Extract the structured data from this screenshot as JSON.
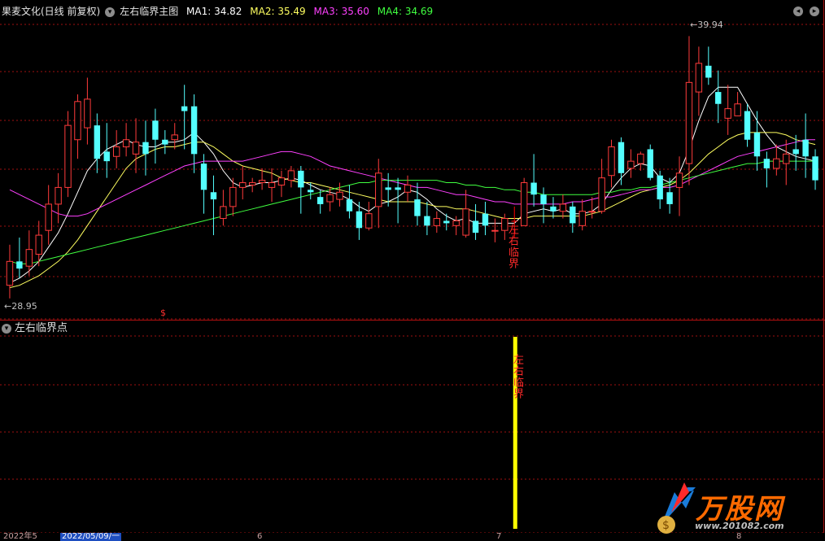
{
  "header": {
    "stock_name": "果麦文化(日线 前复权)",
    "indicator_name": "左右临界主图",
    "ma1": "MA1: 34.82",
    "ma2": "MA2: 35.49",
    "ma3": "MA3: 35.60",
    "ma4": "MA4: 34.69"
  },
  "sub_header": {
    "indicator_name": "左右临界点"
  },
  "price_labels": {
    "high": "39.94",
    "low": "28.95",
    "dollar_marker": "$"
  },
  "signal": {
    "main_label": "左右临界",
    "sub_label": "左右临界"
  },
  "axis": {
    "dates": [
      "2022年5",
      "6",
      "7",
      "8"
    ],
    "cursor_date": "2022/05/09/一"
  },
  "logo": {
    "text": "万股网",
    "url": "www.201082.com"
  },
  "colors": {
    "up": "#ff3b3b",
    "down": "#54ffff",
    "ma1": "#ffffff",
    "ma2": "#ffff60",
    "ma3": "#ff40ff",
    "ma4": "#40ff40",
    "grid": "#a01010",
    "signal_bar": "#ffff00",
    "signal_candle": "#ff0000"
  },
  "chart_data": {
    "type": "candlestick",
    "ylim": [
      28.5,
      40.5
    ],
    "candles": [
      {
        "o": 29.5,
        "c": 30.5,
        "h": 31.2,
        "l": 28.95
      },
      {
        "o": 30.5,
        "c": 30.2,
        "h": 31.5,
        "l": 29.8
      },
      {
        "o": 30.3,
        "c": 31.0,
        "h": 31.8,
        "l": 29.9
      },
      {
        "o": 30.8,
        "c": 31.6,
        "h": 32.2,
        "l": 30.3
      },
      {
        "o": 31.8,
        "c": 32.9,
        "h": 33.7,
        "l": 31.2
      },
      {
        "o": 32.9,
        "c": 33.6,
        "h": 34.2,
        "l": 32.1
      },
      {
        "o": 33.6,
        "c": 36.2,
        "h": 36.8,
        "l": 33.2
      },
      {
        "o": 35.6,
        "c": 37.2,
        "h": 37.5,
        "l": 34.8
      },
      {
        "o": 36.1,
        "c": 37.3,
        "h": 38.2,
        "l": 35.4
      },
      {
        "o": 36.2,
        "c": 34.8,
        "h": 36.7,
        "l": 34.2
      },
      {
        "o": 35.1,
        "c": 34.7,
        "h": 36.3,
        "l": 34.0
      },
      {
        "o": 34.9,
        "c": 35.3,
        "h": 36.0,
        "l": 34.4
      },
      {
        "o": 35.3,
        "c": 35.6,
        "h": 36.3,
        "l": 34.9
      },
      {
        "o": 35.0,
        "c": 35.5,
        "h": 36.5,
        "l": 34.2
      },
      {
        "o": 35.5,
        "c": 35.0,
        "h": 36.4,
        "l": 34.1
      },
      {
        "o": 36.4,
        "c": 35.6,
        "h": 36.9,
        "l": 34.6
      },
      {
        "o": 35.6,
        "c": 35.4,
        "h": 36.0,
        "l": 35.0
      },
      {
        "o": 35.6,
        "c": 35.8,
        "h": 36.3,
        "l": 35.2
      },
      {
        "o": 37.0,
        "c": 36.8,
        "h": 37.9,
        "l": 35.2
      },
      {
        "o": 37.0,
        "c": 35.0,
        "h": 37.5,
        "l": 34.2
      },
      {
        "o": 34.6,
        "c": 33.5,
        "h": 35.0,
        "l": 32.5
      },
      {
        "o": 33.4,
        "c": 33.1,
        "h": 34.1,
        "l": 31.6
      },
      {
        "o": 32.3,
        "c": 32.8,
        "h": 33.5,
        "l": 32.0
      },
      {
        "o": 32.8,
        "c": 33.6,
        "h": 34.0,
        "l": 32.4
      },
      {
        "o": 33.6,
        "c": 33.8,
        "h": 34.5,
        "l": 33.1
      },
      {
        "o": 33.7,
        "c": 33.8,
        "h": 34.0,
        "l": 33.4
      },
      {
        "o": 33.8,
        "c": 33.9,
        "h": 34.4,
        "l": 33.5
      },
      {
        "o": 33.6,
        "c": 33.8,
        "h": 34.4,
        "l": 33.0
      },
      {
        "o": 33.7,
        "c": 34.0,
        "h": 34.3,
        "l": 33.2
      },
      {
        "o": 33.9,
        "c": 34.3,
        "h": 34.5,
        "l": 33.6
      },
      {
        "o": 34.3,
        "c": 33.6,
        "h": 34.5,
        "l": 32.5
      },
      {
        "o": 33.5,
        "c": 33.4,
        "h": 33.8,
        "l": 33.1
      },
      {
        "o": 33.2,
        "c": 32.9,
        "h": 33.5,
        "l": 32.5
      },
      {
        "o": 33.0,
        "c": 33.3,
        "h": 33.6,
        "l": 32.6
      },
      {
        "o": 33.1,
        "c": 33.4,
        "h": 33.8,
        "l": 32.8
      },
      {
        "o": 33.1,
        "c": 32.6,
        "h": 33.7,
        "l": 32.3
      },
      {
        "o": 32.6,
        "c": 31.9,
        "h": 33.0,
        "l": 31.4
      },
      {
        "o": 31.9,
        "c": 32.5,
        "h": 33.0,
        "l": 31.8
      },
      {
        "o": 32.8,
        "c": 34.2,
        "h": 34.8,
        "l": 31.9
      },
      {
        "o": 33.6,
        "c": 33.5,
        "h": 34.2,
        "l": 32.8
      },
      {
        "o": 33.6,
        "c": 33.5,
        "h": 34.0,
        "l": 32.1
      },
      {
        "o": 33.4,
        "c": 33.7,
        "h": 34.1,
        "l": 33.0
      },
      {
        "o": 33.1,
        "c": 32.4,
        "h": 33.8,
        "l": 32.0
      },
      {
        "o": 32.4,
        "c": 32.0,
        "h": 33.0,
        "l": 31.6
      },
      {
        "o": 32.0,
        "c": 32.3,
        "h": 32.6,
        "l": 31.7
      },
      {
        "o": 32.2,
        "c": 32.1,
        "h": 32.5,
        "l": 31.8
      },
      {
        "o": 32.0,
        "c": 32.2,
        "h": 32.4,
        "l": 31.6
      },
      {
        "o": 31.6,
        "c": 32.7,
        "h": 33.5,
        "l": 31.5
      },
      {
        "o": 32.2,
        "c": 31.7,
        "h": 32.9,
        "l": 31.4
      },
      {
        "o": 32.5,
        "c": 32.0,
        "h": 33.0,
        "l": 31.6
      },
      {
        "o": 31.8,
        "c": 31.8,
        "h": 32.3,
        "l": 31.3
      },
      {
        "o": 31.8,
        "c": 32.3,
        "h": 32.5,
        "l": 31.4
      },
      {
        "o": 32.2,
        "c": 32.2,
        "h": 32.8,
        "l": 31.5
      },
      {
        "o": 32.0,
        "c": 33.8,
        "h": 34.0,
        "l": 32.0
      },
      {
        "o": 33.8,
        "c": 33.3,
        "h": 35.0,
        "l": 32.8
      },
      {
        "o": 33.3,
        "c": 32.9,
        "h": 33.6,
        "l": 32.1
      },
      {
        "o": 32.8,
        "c": 32.6,
        "h": 33.2,
        "l": 32.3
      },
      {
        "o": 32.6,
        "c": 32.9,
        "h": 33.3,
        "l": 32.3
      },
      {
        "o": 32.8,
        "c": 32.1,
        "h": 33.0,
        "l": 31.7
      },
      {
        "o": 32.0,
        "c": 32.6,
        "h": 33.1,
        "l": 31.8
      },
      {
        "o": 32.6,
        "c": 32.6,
        "h": 33.2,
        "l": 32.3
      },
      {
        "o": 32.6,
        "c": 34.0,
        "h": 34.8,
        "l": 32.5
      },
      {
        "o": 34.1,
        "c": 35.3,
        "h": 35.6,
        "l": 33.6
      },
      {
        "o": 35.5,
        "c": 34.2,
        "h": 35.7,
        "l": 33.7
      },
      {
        "o": 34.4,
        "c": 34.7,
        "h": 35.2,
        "l": 34.0
      },
      {
        "o": 34.6,
        "c": 35.0,
        "h": 35.1,
        "l": 34.3
      },
      {
        "o": 35.2,
        "c": 34.0,
        "h": 35.4,
        "l": 33.9
      },
      {
        "o": 34.1,
        "c": 33.1,
        "h": 34.3,
        "l": 32.7
      },
      {
        "o": 33.4,
        "c": 32.9,
        "h": 34.0,
        "l": 32.5
      },
      {
        "o": 33.6,
        "c": 34.2,
        "h": 34.9,
        "l": 32.4
      },
      {
        "o": 34.6,
        "c": 38.0,
        "h": 39.94,
        "l": 33.7
      },
      {
        "o": 37.6,
        "c": 38.8,
        "h": 39.5,
        "l": 36.6
      },
      {
        "o": 38.7,
        "c": 38.2,
        "h": 39.5,
        "l": 37.9
      },
      {
        "o": 37.6,
        "c": 37.1,
        "h": 38.5,
        "l": 36.3
      },
      {
        "o": 36.5,
        "c": 36.9,
        "h": 37.9,
        "l": 35.8
      },
      {
        "o": 36.6,
        "c": 37.1,
        "h": 37.6,
        "l": 36.6
      },
      {
        "o": 36.8,
        "c": 35.6,
        "h": 37.1,
        "l": 35.3
      },
      {
        "o": 35.9,
        "c": 34.9,
        "h": 36.8,
        "l": 34.3
      },
      {
        "o": 34.8,
        "c": 34.4,
        "h": 35.1,
        "l": 33.6
      },
      {
        "o": 34.4,
        "c": 34.8,
        "h": 35.4,
        "l": 34.1
      },
      {
        "o": 34.6,
        "c": 35.0,
        "h": 35.6,
        "l": 33.7
      },
      {
        "o": 35.2,
        "c": 35.0,
        "h": 35.8,
        "l": 34.3
      },
      {
        "o": 35.6,
        "c": 34.9,
        "h": 36.7,
        "l": 34.0
      },
      {
        "o": 34.9,
        "c": 33.9,
        "h": 35.2,
        "l": 33.5
      }
    ],
    "signal_index": 52,
    "ma_series": [
      {
        "values": [
          29.6,
          29.8,
          30.1,
          30.5,
          31.1,
          31.7,
          32.5,
          33.4,
          34.3,
          34.8,
          35.2,
          35.4,
          35.6,
          35.4,
          35.3,
          35.3,
          35.5,
          35.5,
          35.6,
          35.9,
          35.5,
          35.0,
          34.3,
          33.8,
          33.6,
          33.7,
          33.8,
          33.8,
          33.9,
          34.0,
          33.9,
          33.7,
          33.5,
          33.4,
          33.3,
          33.1,
          32.8,
          32.6,
          32.9,
          33.0,
          33.2,
          33.5,
          33.4,
          33.1,
          32.7,
          32.4,
          32.2,
          32.3,
          32.1,
          32.1,
          32.1,
          32.1,
          32.1,
          32.5,
          32.6,
          32.7,
          32.6,
          32.7,
          32.5,
          32.5,
          32.6,
          32.9,
          33.5,
          34.0,
          34.4,
          34.6,
          34.5,
          34.0,
          33.8,
          34.2,
          35.2,
          36.4,
          37.4,
          37.8,
          37.8,
          37.8,
          37.1,
          36.4,
          35.8,
          35.3,
          35.1,
          34.9,
          34.8,
          34.7
        ]
      },
      {
        "values": [
          29.4,
          29.5,
          29.7,
          29.9,
          30.2,
          30.5,
          30.9,
          31.4,
          32.0,
          32.6,
          33.2,
          33.8,
          34.4,
          34.8,
          35.0,
          35.2,
          35.3,
          35.3,
          35.4,
          35.5,
          35.5,
          35.3,
          35.0,
          34.7,
          34.5,
          34.4,
          34.3,
          34.2,
          34.0,
          33.9,
          33.8,
          33.8,
          33.7,
          33.6,
          33.5,
          33.4,
          33.3,
          33.2,
          33.1,
          33.0,
          33.0,
          33.0,
          33.0,
          32.9,
          32.8,
          32.8,
          32.7,
          32.7,
          32.6,
          32.5,
          32.4,
          32.3,
          32.3,
          32.3,
          32.4,
          32.4,
          32.4,
          32.4,
          32.4,
          32.4,
          32.5,
          32.6,
          32.8,
          33.0,
          33.2,
          33.4,
          33.5,
          33.6,
          33.7,
          33.9,
          34.2,
          34.6,
          35.0,
          35.3,
          35.6,
          35.8,
          35.9,
          35.9,
          35.9,
          35.9,
          35.8,
          35.6,
          35.5,
          35.4
        ]
      },
      {
        "values": [
          33.5,
          33.3,
          33.1,
          32.9,
          32.7,
          32.5,
          32.4,
          32.4,
          32.5,
          32.7,
          32.9,
          33.1,
          33.3,
          33.5,
          33.7,
          33.9,
          34.1,
          34.3,
          34.5,
          34.6,
          34.7,
          34.7,
          34.7,
          34.7,
          34.7,
          34.8,
          34.9,
          35.0,
          35.1,
          35.1,
          35.0,
          34.9,
          34.7,
          34.5,
          34.4,
          34.3,
          34.2,
          34.1,
          34.0,
          33.9,
          33.8,
          33.7,
          33.6,
          33.6,
          33.5,
          33.4,
          33.3,
          33.3,
          33.2,
          33.1,
          33.0,
          33.0,
          32.9,
          32.9,
          32.9,
          32.9,
          32.9,
          32.9,
          33.0,
          33.0,
          33.1,
          33.2,
          33.2,
          33.3,
          33.4,
          33.5,
          33.5,
          33.6,
          33.6,
          33.7,
          33.9,
          34.1,
          34.3,
          34.5,
          34.7,
          34.9,
          35.0,
          35.1,
          35.2,
          35.3,
          35.4,
          35.5,
          35.6,
          35.6
        ]
      },
      {
        "values": [
          30.5,
          30.4,
          30.4,
          30.5,
          30.6,
          30.7,
          30.8,
          30.9,
          31.0,
          31.1,
          31.2,
          31.3,
          31.4,
          31.5,
          31.6,
          31.7,
          31.8,
          31.9,
          32.0,
          32.1,
          32.2,
          32.3,
          32.4,
          32.5,
          32.6,
          32.7,
          32.8,
          32.9,
          33.0,
          33.1,
          33.2,
          33.3,
          33.4,
          33.5,
          33.6,
          33.7,
          33.8,
          33.8,
          33.9,
          33.9,
          33.9,
          33.9,
          33.9,
          33.9,
          33.9,
          33.8,
          33.8,
          33.7,
          33.7,
          33.6,
          33.6,
          33.5,
          33.5,
          33.4,
          33.4,
          33.3,
          33.3,
          33.3,
          33.3,
          33.3,
          33.3,
          33.4,
          33.4,
          33.5,
          33.5,
          33.6,
          33.6,
          33.7,
          33.8,
          33.9,
          34.0,
          34.1,
          34.2,
          34.3,
          34.4,
          34.5,
          34.6,
          34.6,
          34.7,
          34.7,
          34.7,
          34.7,
          34.7,
          34.7
        ]
      }
    ]
  }
}
